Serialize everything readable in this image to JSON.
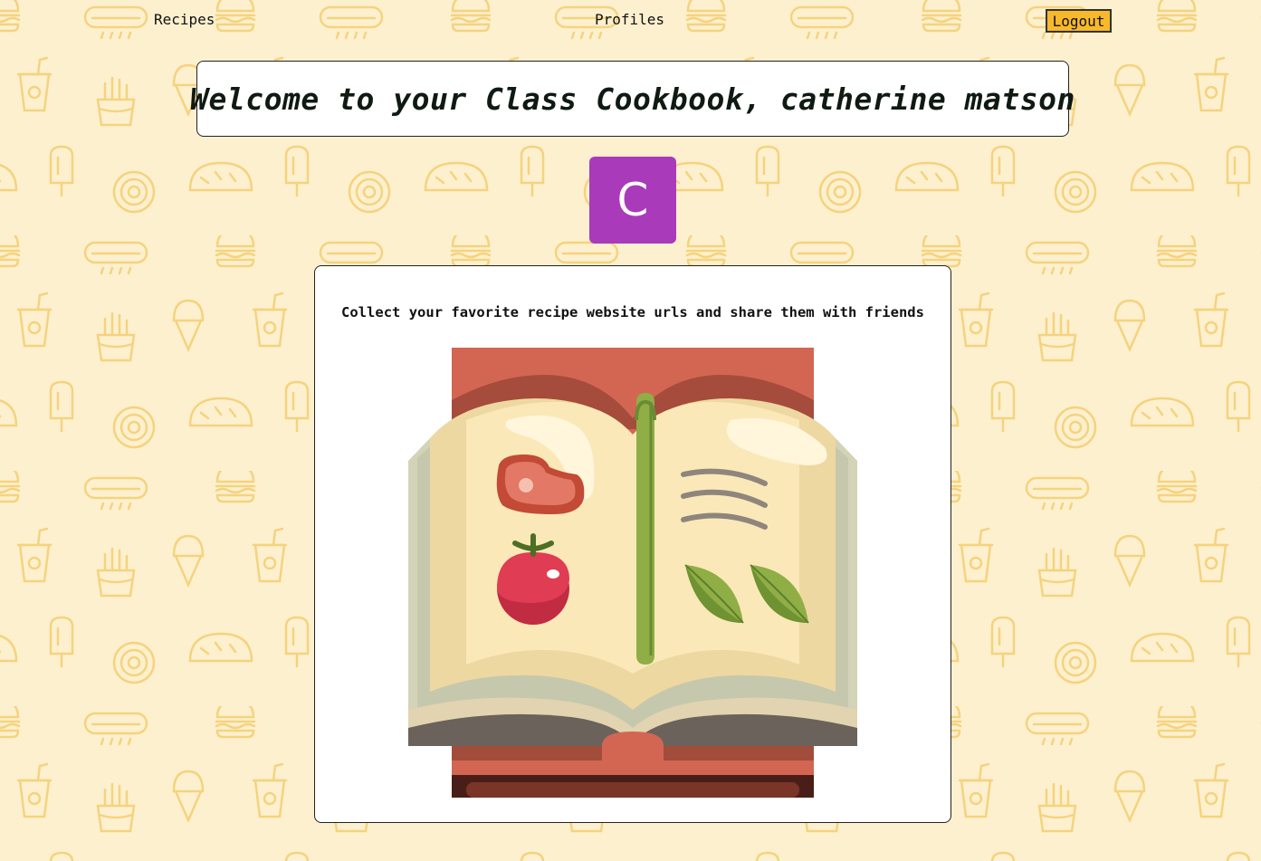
{
  "nav": {
    "recipes_label": "Recipes",
    "profiles_label": "Profiles",
    "logout_label": "Logout"
  },
  "header": {
    "welcome_text": "Welcome to your Class Cookbook, catherine matson"
  },
  "profile": {
    "avatar_initial": "C",
    "avatar_color": "#a93bbb"
  },
  "card": {
    "tagline": "Collect your favorite recipe website urls and share them with friends",
    "illustration_icon": "open-cookbook-icon"
  },
  "colors": {
    "background": "#fdf0cf",
    "pattern": "#f7d77a",
    "logout_button": "#f7b92b"
  }
}
